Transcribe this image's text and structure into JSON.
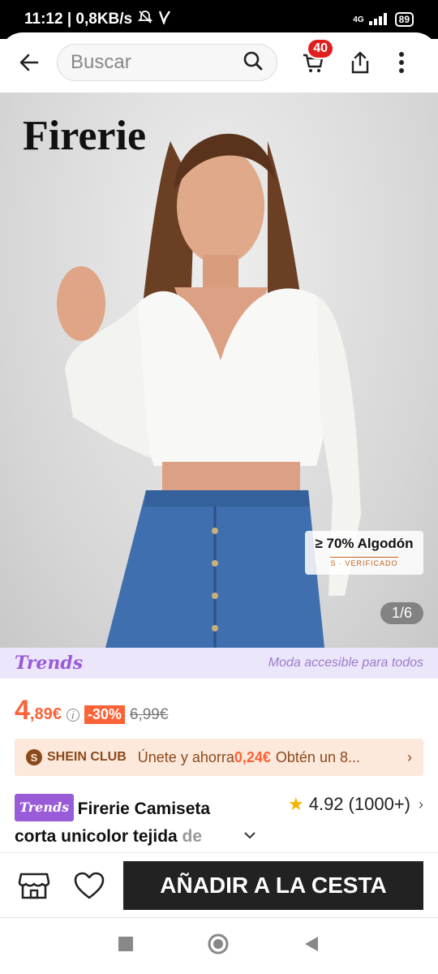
{
  "status_bar": {
    "time_speed": "11:12 | 0,8KB/s",
    "network": "4G",
    "battery": "89"
  },
  "header": {
    "search_placeholder": "Buscar",
    "cart_count": "40"
  },
  "hero": {
    "brand_watermark": "Firerie",
    "material_title": "≥ 70% Algodón",
    "material_verified": "S · VERIFICADO",
    "image_counter": "1/6"
  },
  "trends": {
    "logo": "Trends",
    "slogan": "Moda accesible para todos"
  },
  "price": {
    "main": "4",
    "decimal": ",89€",
    "discount": "-30%",
    "original": "6,99€"
  },
  "club": {
    "icon_letter": "S",
    "label": "SHEIN CLUB",
    "text": "Únete y ahorra",
    "amount": "0,24€",
    "tail": "Obtén un 8..."
  },
  "product": {
    "tag": "Trends",
    "title_line1": "Firerie Camiseta",
    "title_line2": "corta unicolor tejida ",
    "title_fade": "de",
    "rating": "4.92",
    "review_count": "(1000+)"
  },
  "bottom_bar": {
    "add_to_cart": "AÑADIR A LA CESTA"
  },
  "colors": {
    "accent": "#fa6338",
    "trends_purple": "#9a5bd8",
    "club_brown": "#8b4a1c",
    "cta_bg": "#222222"
  }
}
